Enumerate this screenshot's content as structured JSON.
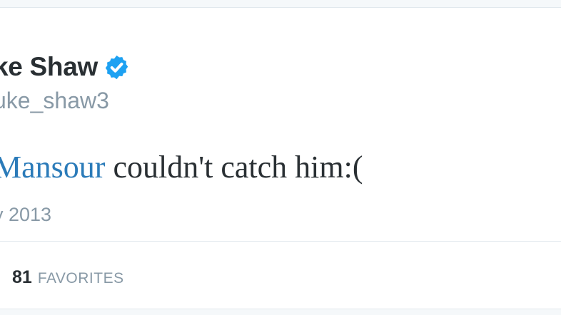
{
  "tweet": {
    "display_name_visible": "ke Shaw",
    "verified_icon": "verified-badge-icon",
    "handle_visible": "uke_shaw3",
    "text": {
      "mention_visible": "Mansour",
      "body": " couldn't catch him:("
    },
    "timestamp_visible": "y 2013",
    "stats": {
      "favorites_count": "81",
      "favorites_label": "FAVORITES"
    }
  },
  "colors": {
    "text": "#292f33",
    "muted": "#8899a6",
    "link": "#2b7bb9",
    "verified": "#1da1f2",
    "border": "#e1e8ed"
  }
}
